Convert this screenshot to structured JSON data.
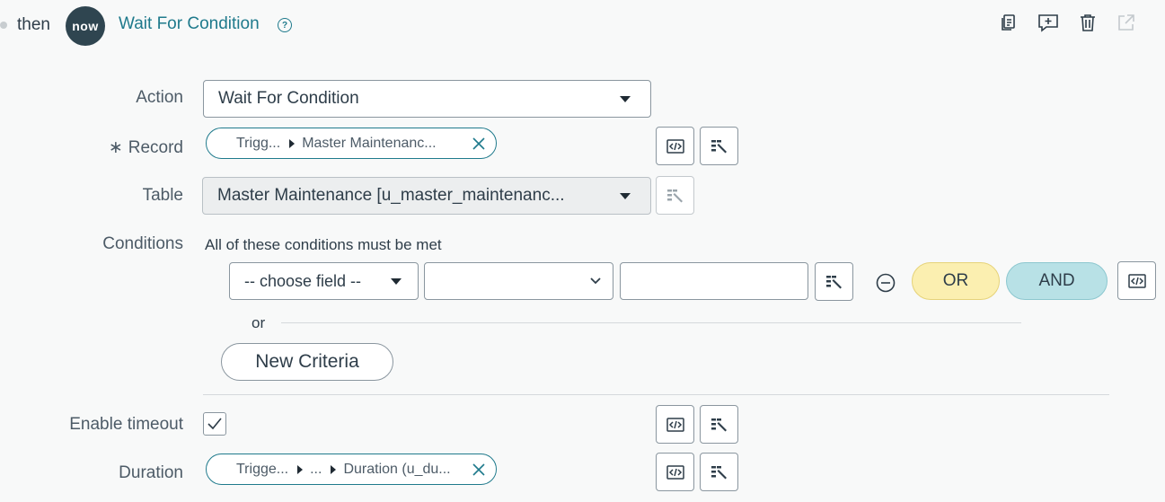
{
  "step": {
    "connector": "then",
    "logo_text": "now",
    "title": "Wait For Condition",
    "help_glyph": "?"
  },
  "toolbar": {
    "icons": [
      "copy-icon",
      "add-comment-icon",
      "delete-icon",
      "open-external-icon"
    ]
  },
  "action": {
    "label": "Action",
    "value": "Wait For Condition"
  },
  "record": {
    "label": "Record",
    "required_marker": "∗",
    "pill_segment_1": "Trigg...",
    "pill_segment_2": "Master Maintenanc..."
  },
  "table": {
    "label": "Table",
    "value": "Master Maintenance [u_master_maintenanc..."
  },
  "conditions": {
    "label": "Conditions",
    "description": "All of these conditions must be met",
    "field_placeholder": "-- choose field --",
    "operator_value": "",
    "value_value": "",
    "or_button": "OR",
    "and_button": "AND",
    "or_separator": "or",
    "new_criteria": "New Criteria"
  },
  "timeout": {
    "label": "Enable timeout",
    "checked": true
  },
  "duration": {
    "label": "Duration",
    "pill_segment_1": "Trigge...",
    "pill_segment_2": "...",
    "pill_segment_3": "Duration (u_du..."
  },
  "colors": {
    "accent": "#1f7a8c",
    "or_button": "#fbefb0",
    "and_button": "#b8e1e6",
    "logo_bg": "#2f4550"
  }
}
